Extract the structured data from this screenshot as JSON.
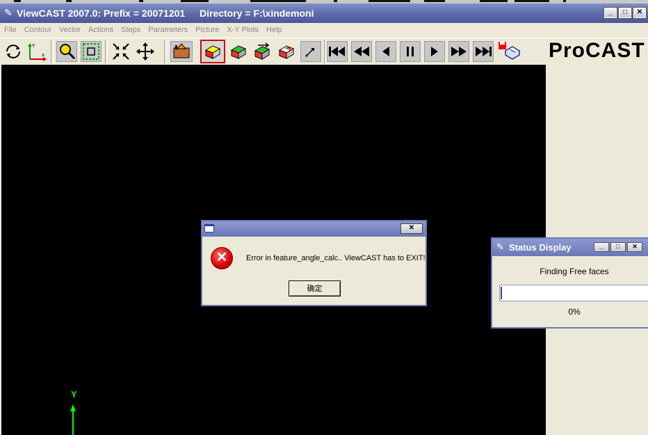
{
  "window": {
    "title": "ViewCAST 2007.0: Prefix = 20071201",
    "directory": "Directory = F:\\xindemoni",
    "min_label": "_",
    "max_label": "□",
    "close_label": "✕"
  },
  "menu": {
    "items": [
      "File",
      "Contour",
      "Vector",
      "Actions",
      "Steps",
      "Parameters",
      "Picture",
      "X-Y Plots",
      "Help"
    ]
  },
  "toolbar": {
    "brand": "ProCAST",
    "icons": {
      "rotate": "rotate-icon",
      "axes": "axes-icon",
      "zoom": "zoom-icon",
      "box": "box-select-icon",
      "shrink": "fit-icon",
      "move": "pan-icon",
      "home": "mesh-home-icon",
      "sel1": "solid-red-icon",
      "sel2": "solid-green-icon",
      "sel3": "solid-arrow-icon",
      "sel4": "solid-cut-icon",
      "diag": "diagonal-arrow-icon",
      "first": "first-step-icon",
      "rewind": "rewind-icon",
      "back": "step-back-icon",
      "pause": "pause-icon",
      "play": "play-icon",
      "forward": "fast-forward-icon",
      "last": "last-step-icon",
      "save": "save-icon",
      "print": "print-icon"
    }
  },
  "viewport": {
    "axis_label": "Y",
    "axis_color": "#00ff00"
  },
  "error_dialog": {
    "message": "Error in feature_angle_calc.. ViewCAST has to EXIT!",
    "ok_label": "确定",
    "close_label": "✕",
    "icon_glyph": "✕"
  },
  "status_dialog": {
    "title": "Status Display",
    "message": "Finding Free faces",
    "progress_percent": 0,
    "progress_text": "0%",
    "min_label": "_",
    "max_label": "□",
    "close_label": "✕"
  }
}
